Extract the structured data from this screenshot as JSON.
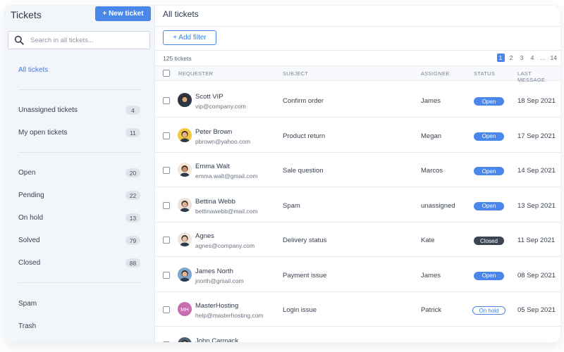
{
  "sidebar": {
    "title": "Tickets",
    "new_ticket": "+ New ticket",
    "search_placeholder": "Search in all tickets...",
    "all_tickets": "All tickets",
    "group1": [
      {
        "label": "Unassigned tickets",
        "count": "4"
      },
      {
        "label": "My open tickets",
        "count": "11"
      }
    ],
    "group2": [
      {
        "label": "Open",
        "count": "20"
      },
      {
        "label": "Pending",
        "count": "22"
      },
      {
        "label": "On hold",
        "count": "13"
      },
      {
        "label": "Solved",
        "count": "79"
      },
      {
        "label": "Closed",
        "count": "88"
      }
    ],
    "group3": [
      {
        "label": "Spam"
      },
      {
        "label": "Trash"
      }
    ]
  },
  "main": {
    "title": "All tickets",
    "add_filter": "+ Add filter",
    "total": "125 tickets",
    "pages": [
      "1",
      "2",
      "3",
      "4",
      "...",
      "14"
    ],
    "current_page": "1",
    "columns": [
      "REQUESTER",
      "SUBJECT",
      "ASSIGNEE",
      "STATUS",
      "LAST MESSAGE"
    ]
  },
  "tickets": [
    {
      "name": "Scott VIP",
      "email": "vip@company.com",
      "subject": "Confirm order",
      "assignee": "James",
      "status": "Open",
      "last": "18 Sep 2021",
      "avatar": "photo",
      "avatar_color": "#2f3540",
      "skin": "#d9a982"
    },
    {
      "name": "Peter Brown",
      "email": "pbrown@yahoo.com",
      "subject": "Product return",
      "assignee": "Megan",
      "status": "Open",
      "last": "17 Sep 2021",
      "avatar": "photo",
      "avatar_color": "#f5c842",
      "skin": "#e8b48f"
    },
    {
      "name": "Emma Walt",
      "email": "emma.walt@gmail.com",
      "subject": "Sale question",
      "assignee": "Marcos",
      "status": "Open",
      "last": "14 Sep 2021",
      "avatar": "photo",
      "avatar_color": "#f7e7d6",
      "skin": "#c98f6a"
    },
    {
      "name": "Bettina Webb",
      "email": "bettinawebb@mail.com",
      "subject": "Spam",
      "assignee": "unassigned",
      "status": "Open",
      "last": "13 Sep 2021",
      "avatar": "photo",
      "avatar_color": "#f1dfd9",
      "skin": "#e2ad90"
    },
    {
      "name": "Agnes",
      "email": "agnes@company.com",
      "subject": "Delivery status",
      "assignee": "Kate",
      "status": "Closed",
      "last": "11 Sep 2021",
      "avatar": "photo",
      "avatar_color": "#ece6df",
      "skin": "#eac3a8"
    },
    {
      "name": "James North",
      "email": "jnorth@gmail.com",
      "subject": "Payment issue",
      "assignee": "James",
      "status": "Open",
      "last": "08 Sep 2021",
      "avatar": "photo",
      "avatar_color": "#7fa6cf",
      "skin": "#e5b796"
    },
    {
      "name": "MasterHosting",
      "email": "help@masterhosting.com",
      "subject": "Login issue",
      "assignee": "Patrick",
      "status": "On hold",
      "last": "05 Sep 2021",
      "avatar": "initials",
      "initials": "MH",
      "avatar_color": "#c56fb0"
    },
    {
      "name": "John Carmack",
      "email": "",
      "subject": "",
      "assignee": "",
      "status": "",
      "last": "",
      "avatar": "photo",
      "avatar_color": "#4f5f73",
      "skin": "#d9a982"
    }
  ]
}
